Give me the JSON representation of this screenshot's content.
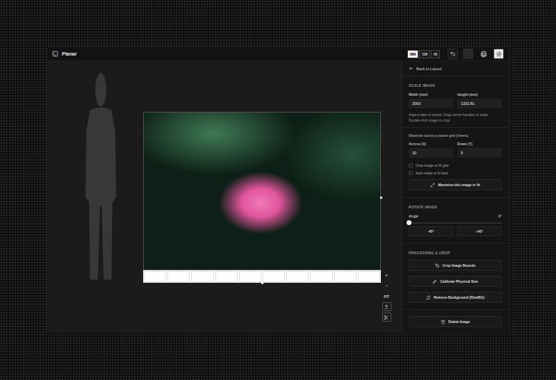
{
  "app": {
    "name": "Planar"
  },
  "units": [
    {
      "label": "MM",
      "selected": true
    },
    {
      "label": "CM",
      "selected": false
    },
    {
      "label": "IN",
      "selected": false
    }
  ],
  "canvas": {
    "zoom": [
      "+",
      "−",
      "FIT"
    ]
  },
  "panel": {
    "back": "Back to Layout",
    "scale": {
      "title": "SCALE IMAGE",
      "width_label": "Width (mm)",
      "width": "2000",
      "height_label": "Height (mm)",
      "height": "1332.81",
      "help": [
        "Aspect ratio is locked. Drag corner handles to scale.",
        "Double-click image to crop."
      ]
    },
    "grid": {
      "title": "Maximize across a poster grid (sheets)",
      "across_label": "Across (X)",
      "across": "10",
      "down_label": "Down (Y)",
      "down": "5",
      "options": [
        {
          "label": "Crop image to fill grid",
          "checked": false
        },
        {
          "label": "Auto-rotate to fit best",
          "checked": false
        }
      ],
      "button": "Maximize this image to fit"
    },
    "rotate": {
      "title": "ROTATE IMAGE",
      "angle_label": "Angle",
      "angle": "0°",
      "level": 0,
      "buttons": [
        "-45°",
        "+45°"
      ]
    },
    "processing": {
      "title": "PROCESSING & CROP",
      "buttons": [
        "Crop Image Bounds",
        "Calibrate Physical Size",
        "Remove Background (RemBG)"
      ]
    },
    "delete": "Delete Image"
  }
}
